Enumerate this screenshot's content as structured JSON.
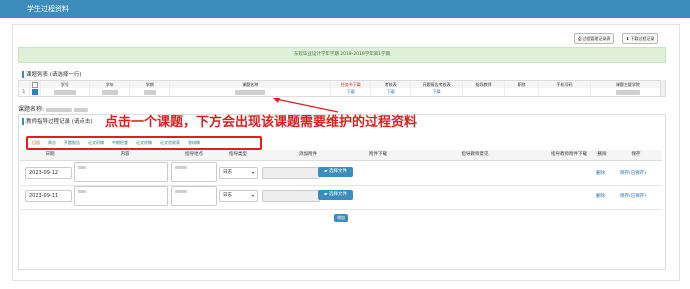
{
  "window": {
    "title": "学生过程资料"
  },
  "toolbar": {
    "btn_records": "过程管理记录表",
    "btn_records_icon": "print-icon",
    "btn_download": "下载过程记录",
    "btn_download_icon": "download-icon"
  },
  "banner": {
    "text": "东软毕业设计学年学期 2018-2019学年第1学期"
  },
  "topic_list": {
    "title": "课题列表 (请选择一行)",
    "columns": [
      "",
      "",
      "学号",
      "学年",
      "学期",
      "课题名称",
      "任务书下载",
      "考核表",
      "开题报告考核表",
      "指导教师",
      "职称",
      "手机号码",
      "课题主管学院"
    ],
    "row": {
      "index": "1",
      "task_download": "下载",
      "exam_download": "下载",
      "opening_download": "下载"
    }
  },
  "course": {
    "label": "课题名称:"
  },
  "records": {
    "title": "教师指导过程记录 (请点击)",
    "tabs": [
      "日志",
      "周志",
      "开题报告",
      "论文初稿",
      "中期检查",
      "论文终稿",
      "论文验收表",
      "答辩稿"
    ],
    "active_tab": 0,
    "headers": {
      "date": "日期",
      "content": "内容",
      "location": "指导地点",
      "type": "指导类型",
      "attach": "添加附件",
      "attach_dl": "附件下载",
      "opinion": "指导教师意见",
      "teacher_attach": "指导教师附件下载",
      "delete": "删除",
      "save": "保存"
    },
    "rows": [
      {
        "date": "2023-09-12",
        "type": "日志",
        "choose_file": "选择文件",
        "delete": "删除",
        "save": "保存(已保存)"
      },
      {
        "date": "2023-09-11",
        "type": "日志",
        "choose_file": "选择文件",
        "delete": "删除",
        "save": "保存(已保存)"
      }
    ],
    "add_button": "增加"
  },
  "annotation": {
    "text": "点击一个课题，下方会出现该课题需要维护的过程资料",
    "color": "#e02020"
  },
  "colors": {
    "header": "#3c8dbc",
    "accent_red": "#e02020",
    "banner": "#dff0d8"
  }
}
